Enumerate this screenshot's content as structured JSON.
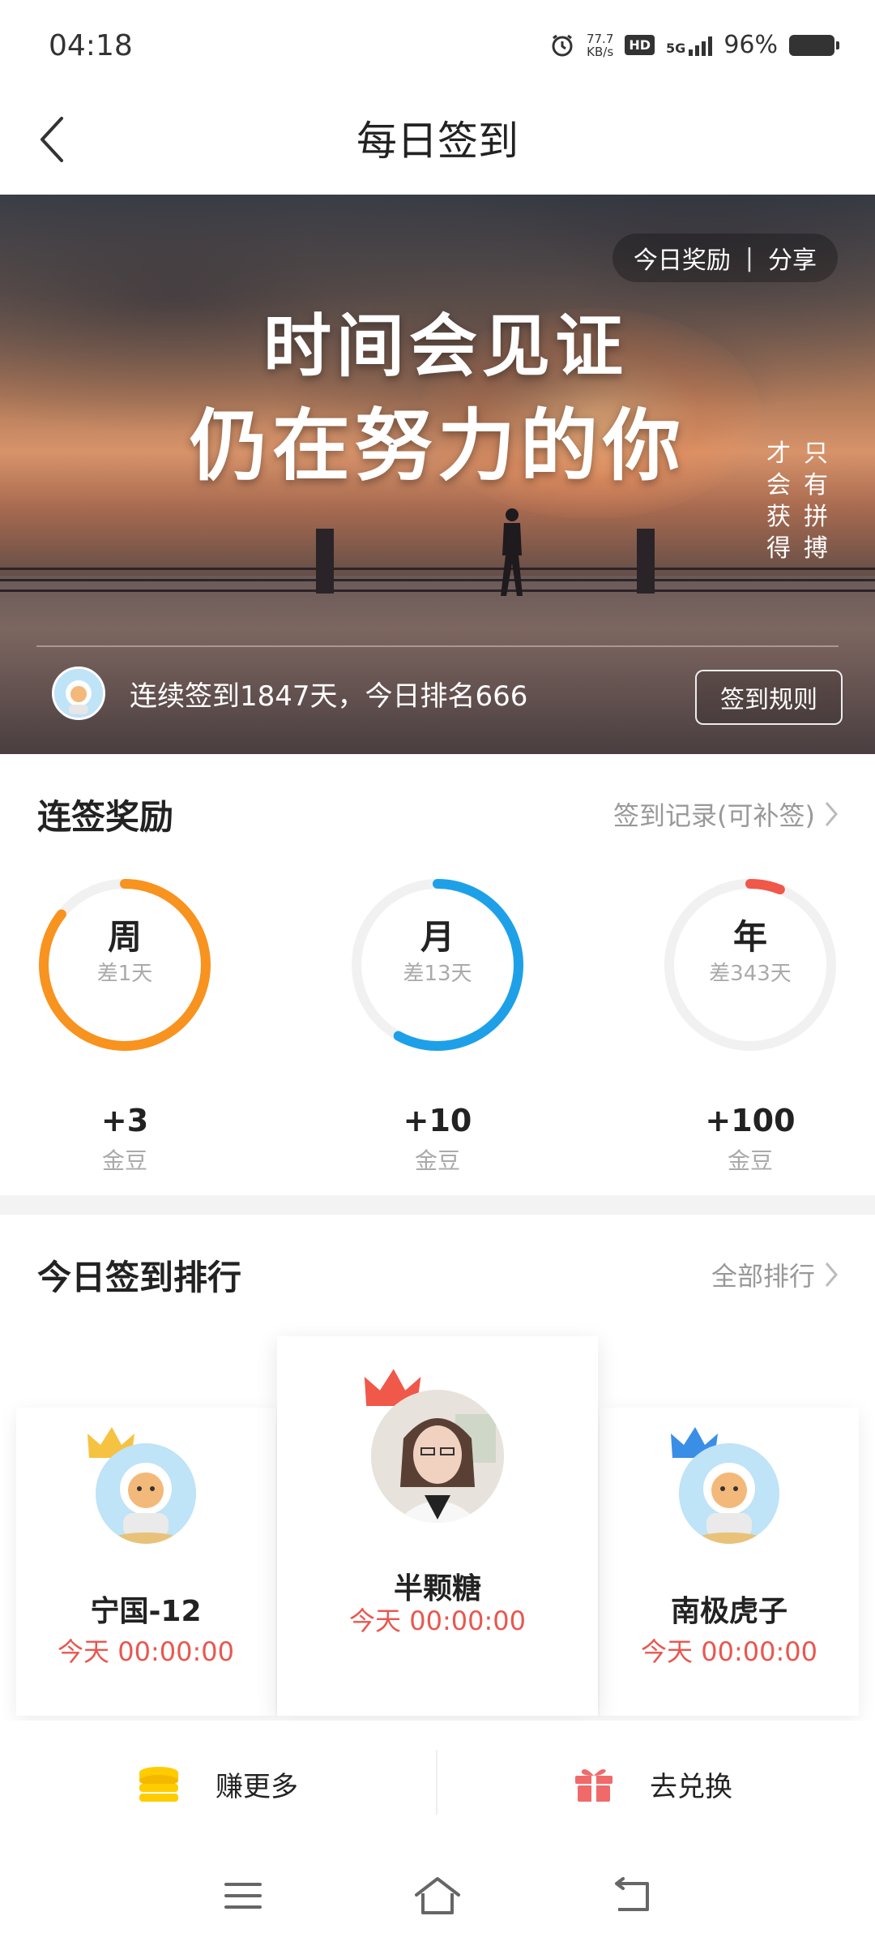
{
  "status_bar": {
    "time": "04:18",
    "net_speed_value": "77.7",
    "net_speed_unit": "KB/s",
    "hd": "HD",
    "network": "5G",
    "battery": "96%"
  },
  "header": {
    "title": "每日签到"
  },
  "banner": {
    "reward_label": "今日奖励",
    "separator": "|",
    "share_label": "分享",
    "slogan_line1": "时间会见证",
    "slogan_line2": "仍在努力的你",
    "vertical_col1": "只有拼搏",
    "vertical_col2": "才会获得",
    "stats_text": "连续签到1847天，今日排名666",
    "rules_button": "签到规则"
  },
  "rewards": {
    "title": "连签奖励",
    "record_link": "签到记录(可补签)",
    "items": [
      {
        "label": "周",
        "remaining": "差1天",
        "amount": "+3",
        "unit": "金豆",
        "progress": 0.857,
        "color": "#f7931e"
      },
      {
        "label": "月",
        "remaining": "差13天",
        "amount": "+10",
        "unit": "金豆",
        "progress": 0.58,
        "color": "#1ea0e8"
      },
      {
        "label": "年",
        "remaining": "差343天",
        "amount": "+100",
        "unit": "金豆",
        "progress": 0.06,
        "color": "#f0584a"
      }
    ]
  },
  "ranking": {
    "title": "今日签到排行",
    "all_link": "全部排行",
    "entries": [
      {
        "name": "宁国-12",
        "time": "今天 00:00:00",
        "crown_color": "#f5c242"
      },
      {
        "name": "半颗糖",
        "time": "今天 00:00:00",
        "crown_color": "#f0584a"
      },
      {
        "name": "南极虎子",
        "time": "今天 00:00:00",
        "crown_color": "#3a8ee6"
      }
    ]
  },
  "actions": {
    "earn_more": "赚更多",
    "exchange": "去兑换"
  }
}
